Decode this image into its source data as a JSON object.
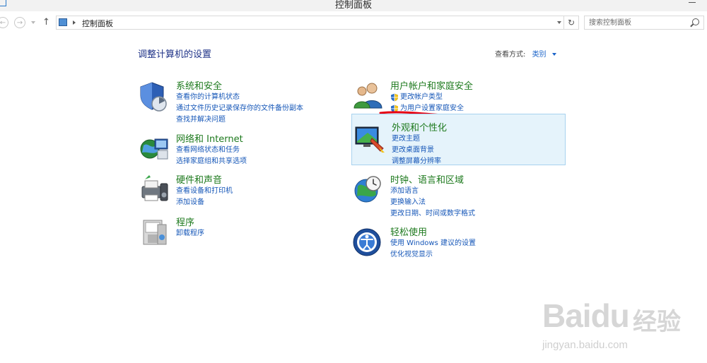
{
  "window": {
    "title": "控制面板"
  },
  "address": {
    "crumb": "控制面板"
  },
  "search": {
    "placeholder": "搜索控制面板"
  },
  "header": {
    "title": "调整计算机的设置",
    "viewby_label": "查看方式:",
    "viewby_value": "类别"
  },
  "categories": [
    {
      "title": "系统和安全",
      "links": [
        "查看你的计算机状态",
        "通过文件历史记录保存你的文件备份副本",
        "查找并解决问题"
      ]
    },
    {
      "title": "网络和 Internet",
      "links": [
        "查看网络状态和任务",
        "选择家庭组和共享选项"
      ]
    },
    {
      "title": "硬件和声音",
      "links": [
        "查看设备和打印机",
        "添加设备"
      ]
    },
    {
      "title": "程序",
      "links": [
        "卸载程序"
      ]
    },
    {
      "title": "用户帐户和家庭安全",
      "links": [
        "更改帐户类型",
        "为用户设置家庭安全"
      ]
    },
    {
      "title": "外观和个性化",
      "links": [
        "更改主题",
        "更改桌面背景",
        "调整屏幕分辨率"
      ]
    },
    {
      "title": "时钟、语言和区域",
      "links": [
        "添加语言",
        "更换输入法",
        "更改日期、时间或数字格式"
      ]
    },
    {
      "title": "轻松使用",
      "links": [
        "使用 Windows 建议的设置",
        "优化视觉显示"
      ]
    }
  ],
  "watermark": {
    "logo": "Baidu",
    "cn": "经验",
    "url": "jingyan.baidu.com"
  },
  "colors": {
    "category_title": "#1e7a1e",
    "link": "#1657b8",
    "heading": "#1e3287",
    "highlight_bg": "#e5f3fb",
    "annotation": "#e60012"
  }
}
